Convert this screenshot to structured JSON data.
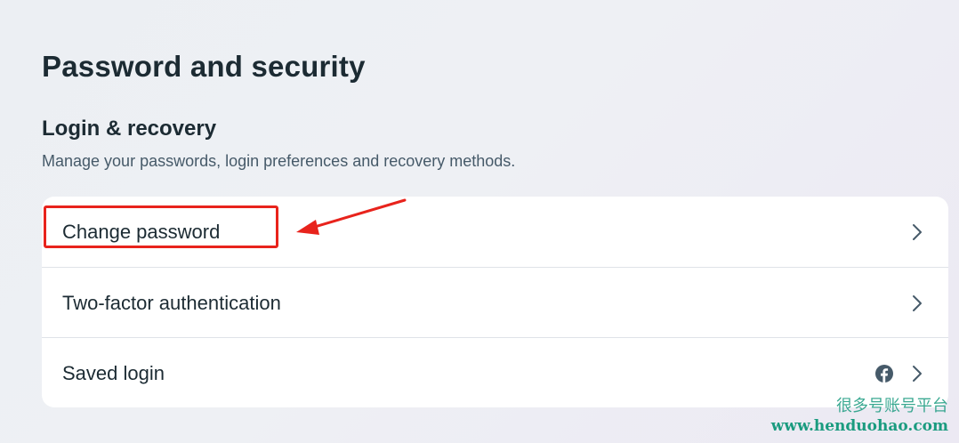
{
  "page": {
    "title": "Password and security"
  },
  "section": {
    "title": "Login & recovery",
    "description": "Manage your passwords, login preferences and recovery methods."
  },
  "options": [
    {
      "label": "Change password",
      "icon": "chevron-right-icon"
    },
    {
      "label": "Two-factor authentication",
      "icon": "chevron-right-icon"
    },
    {
      "label": "Saved login",
      "icon": "chevron-right-icon",
      "extra_icon": "facebook-icon"
    }
  ],
  "annotation": {
    "highlight_color": "#e8231c",
    "target": "Change password"
  },
  "watermark": {
    "text_cn": "很多号账号平台",
    "url": "www.henduohao.com",
    "color": "#1a9b7f"
  },
  "colors": {
    "text_primary": "#1c2b33",
    "text_secondary": "#465a69",
    "card_bg": "#ffffff",
    "divider": "#dfe3e8"
  }
}
